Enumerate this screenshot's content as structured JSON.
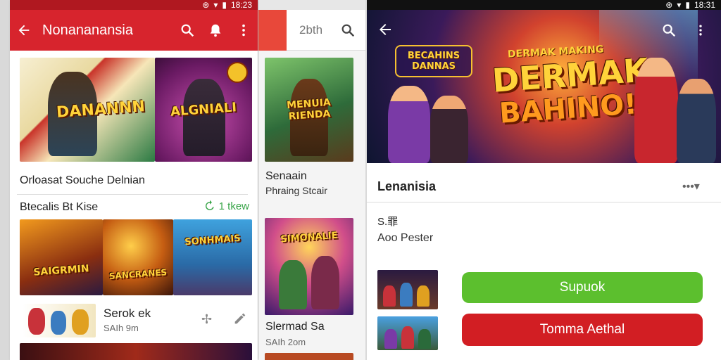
{
  "status": {
    "left_time": "18:23",
    "right_time": "18:31"
  },
  "panel1": {
    "title": "Nonananansia",
    "card1_cap": "DANANNN",
    "card2_cap": "ALGNIALI",
    "card1_badge": "",
    "section_title": "Orloasat Souche Delnian",
    "list_header": "Btecalis Bt Kise",
    "list_action": "1 tkew",
    "strip1_cap": "SAIGRMIN",
    "strip2_cap": "SANCRANES",
    "strip3_cap": "SONHMAIS",
    "row_title": "Serok ek",
    "row_sub": "SAIh 9m"
  },
  "panel2": {
    "search_text": "2bth",
    "card1_cap": "MENUIA RIENDA",
    "card1_title": "Senaain",
    "card1_sub": "Phraing Stcair",
    "card2_cap": "SIMONALIE",
    "card2_title": "Slermad Sa",
    "card2_sub": "SAIh 2om"
  },
  "panel3": {
    "banner_logo": "BECAHINS DANNAS",
    "banner_small": "DERMAK MAKING",
    "banner_big1": "DERMAK",
    "banner_big2": "BAHINO!",
    "app_name": "Lenanisia",
    "rating": "S.罪",
    "author": "Aoo Pester",
    "btn_install": "Supuok",
    "btn_cancel": "Tomma  Aethal"
  },
  "colors": {
    "red": "#d7242d",
    "green": "#5cbf2e",
    "dark_red": "#d21e23"
  }
}
